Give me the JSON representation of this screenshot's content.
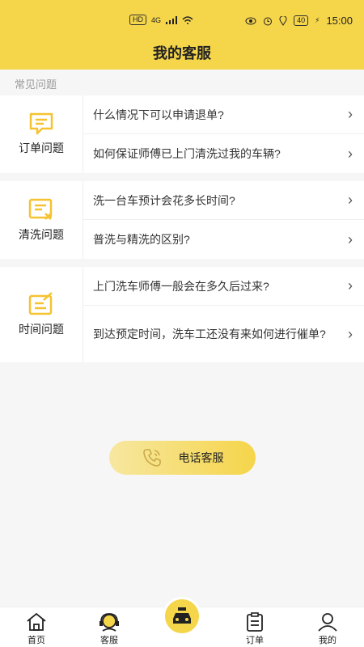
{
  "status_bar": {
    "network": "HD",
    "signal": "4G",
    "battery": "40",
    "time": "15:00"
  },
  "header": {
    "title": "我的客服"
  },
  "faq": {
    "section_label": "常见问题",
    "groups": [
      {
        "category": "订单问题",
        "icon": "order-icon",
        "questions": [
          "什么情况下可以申请退单?",
          "如何保证师傅已上门清洗过我的车辆?"
        ]
      },
      {
        "category": "清洗问题",
        "icon": "wash-icon",
        "questions": [
          "洗一台车预计会花多长时间?",
          "普洗与精洗的区别?"
        ]
      },
      {
        "category": "时间问题",
        "icon": "time-icon",
        "questions": [
          "上门洗车师傅一般会在多久后过来?",
          "到达预定时间，洗车工还没有来如何进行催单?"
        ]
      }
    ]
  },
  "phone_button": {
    "label": "电话客服",
    "icon": "phone-icon"
  },
  "tabbar": {
    "items": [
      {
        "label": "首页",
        "icon": "home-icon"
      },
      {
        "label": "客服",
        "icon": "service-icon"
      },
      {
        "label": "",
        "icon": "car-wash-icon"
      },
      {
        "label": "订单",
        "icon": "order-list-icon"
      },
      {
        "label": "我的",
        "icon": "profile-icon"
      }
    ]
  },
  "colors": {
    "accent": "#f5d54a",
    "background": "#f6f6f6"
  }
}
